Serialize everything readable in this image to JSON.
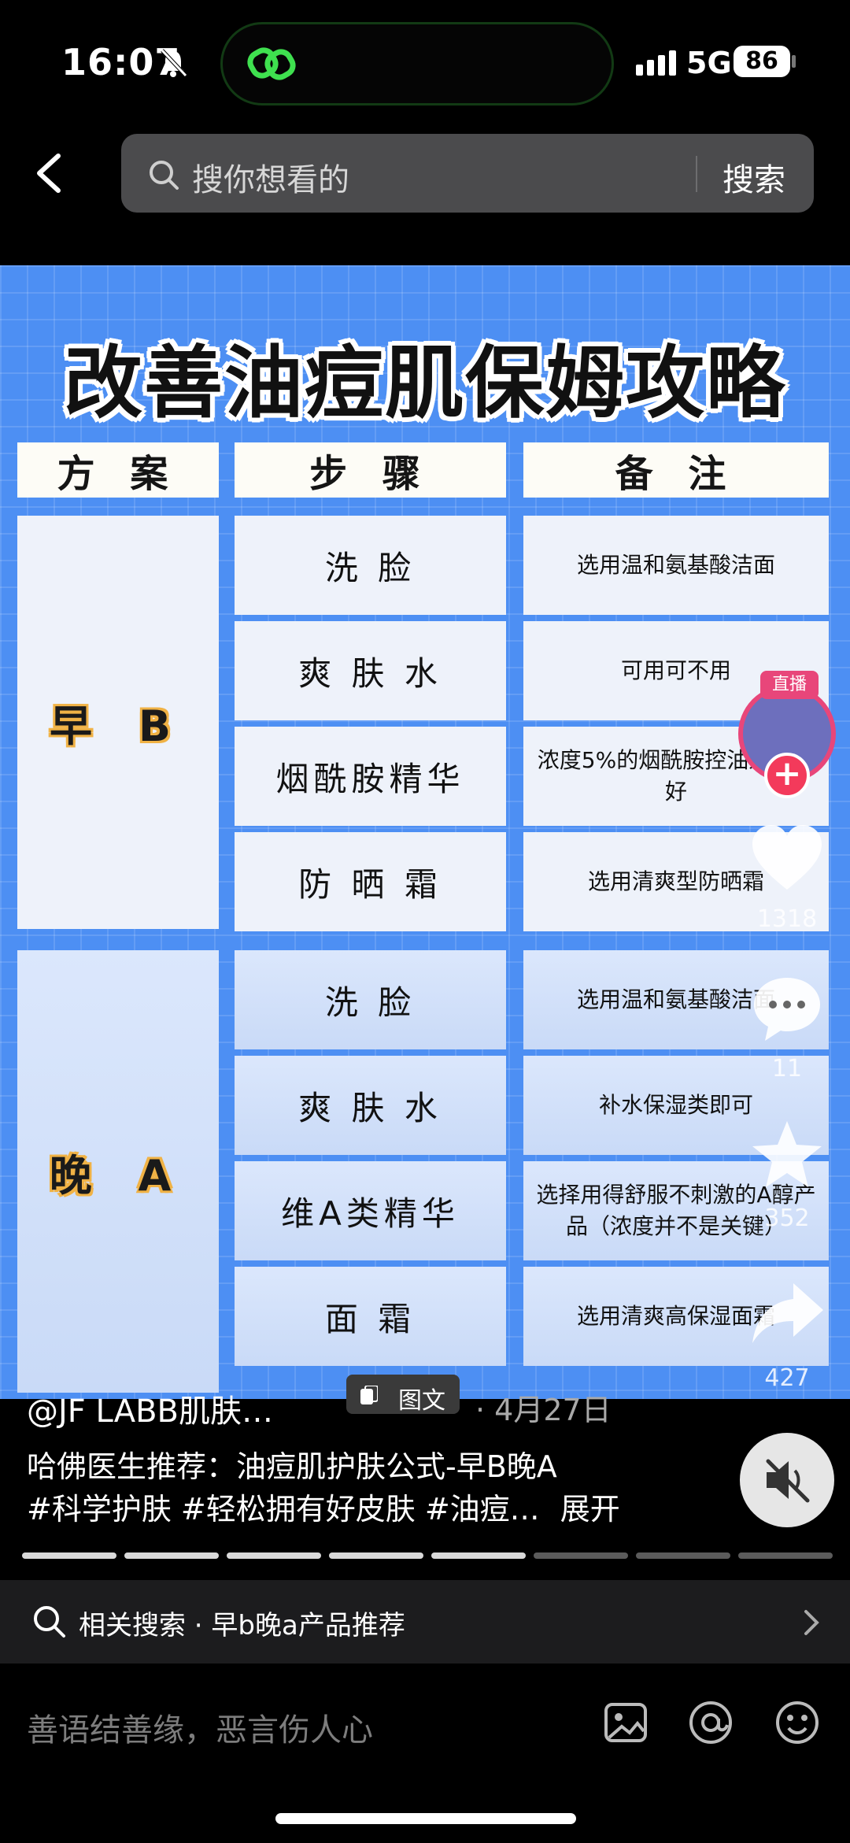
{
  "status": {
    "time": "16:07",
    "network": "5G",
    "battery": "86"
  },
  "search": {
    "placeholder": "搜你想看的",
    "button": "搜索"
  },
  "poster": {
    "title": "改善油痘肌保姆攻略",
    "headers": [
      "方 案",
      "步 骤",
      "备 注"
    ],
    "morning": {
      "plan": "早 B",
      "rows": [
        {
          "step": "洗 脸",
          "note": "选用温和氨基酸洁面"
        },
        {
          "step": "爽 肤 水",
          "note": "可用可不用"
        },
        {
          "step": "烟酰胺精华",
          "note": "浓度5%的烟酰胺控油效果更好"
        },
        {
          "step": "防 晒 霜",
          "note": "选用清爽型防晒霜"
        }
      ]
    },
    "night": {
      "plan": "晚 A",
      "rows": [
        {
          "step": "洗 脸",
          "note": "选用温和氨基酸洁面"
        },
        {
          "step": "爽 肤 水",
          "note": "补水保湿类即可"
        },
        {
          "step": "维A类精华",
          "note": "选择用得舒服不刺激的A醇产品（浓度并不是关键）"
        },
        {
          "step": "面 霜",
          "note": "选用清爽高保湿面霜"
        }
      ]
    }
  },
  "rail": {
    "live_label": "直播",
    "follow": "+",
    "likes": "1318",
    "comments": "11",
    "favorites": "352",
    "shares": "427"
  },
  "post": {
    "author": "@JF LABB肌肤…",
    "type_tag": "图文",
    "date": "· 4月27日",
    "description": "哈佛医生推荐：油痘肌护肤公式-早B晚A",
    "hashtags": "#科学护肤 #轻松拥有好皮肤 #油痘…",
    "expand": "展开",
    "progress_done": 5,
    "progress_total": 8
  },
  "related": {
    "label": "相关搜索 · 早b晚a产品推荐"
  },
  "comment": {
    "placeholder": "善语结善缘，恶言伤人心"
  },
  "colors": {
    "poster_bg": "#4d8ff3",
    "accent_pink": "#e8467a",
    "plan_outline": "#f0b245"
  }
}
